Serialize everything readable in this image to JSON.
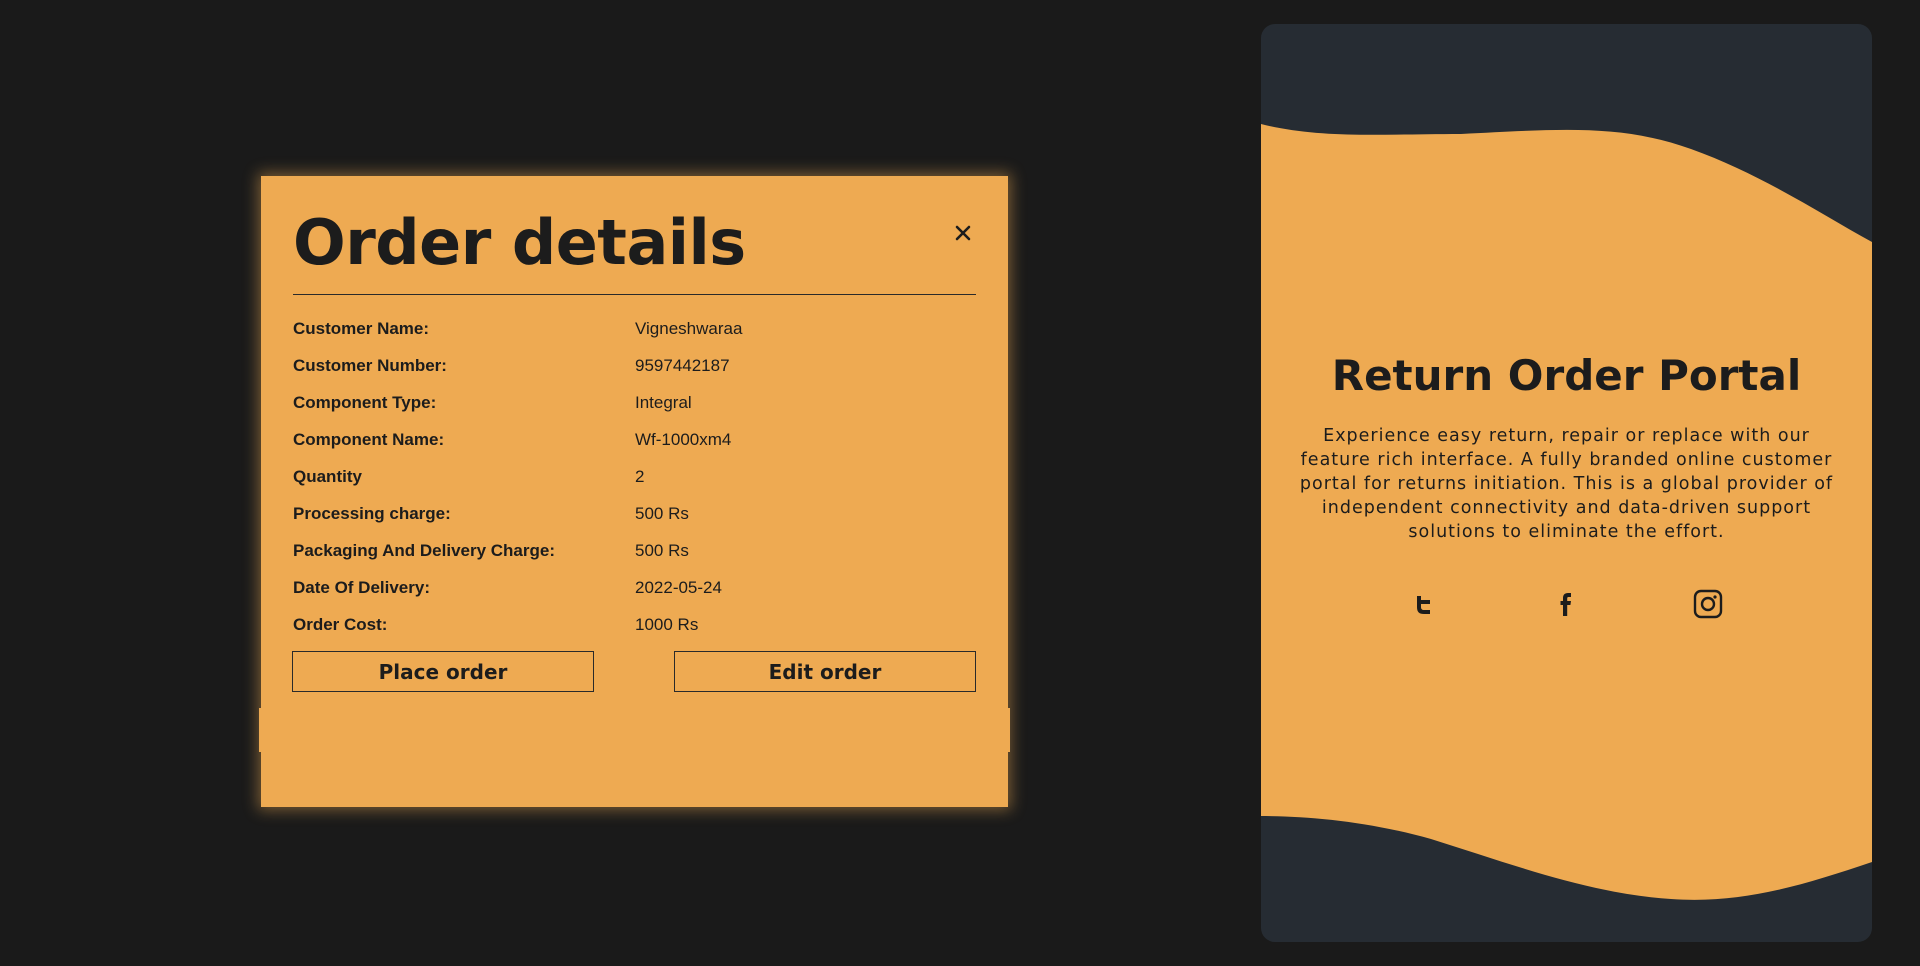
{
  "modal": {
    "title": "Order details",
    "close_icon": "close-icon",
    "rows": [
      {
        "label": "Customer Name:",
        "value": "Vigneshwaraa"
      },
      {
        "label": "Customer Number:",
        "value": "9597442187"
      },
      {
        "label": "Component Type:",
        "value": "Integral"
      },
      {
        "label": "Component Name:",
        "value": "Wf-1000xm4"
      },
      {
        "label": "Quantity",
        "value": "2"
      },
      {
        "label": "Processing charge:",
        "value": "500 Rs"
      },
      {
        "label": "Packaging And Delivery Charge:",
        "value": "500 Rs"
      },
      {
        "label": "Date Of Delivery:",
        "value": "2022-05-24"
      },
      {
        "label": "Order Cost:",
        "value": "1000 Rs"
      }
    ],
    "place_order_label": "Place order",
    "edit_order_label": "Edit order"
  },
  "panel": {
    "title": "Return Order Portal",
    "description": "Experience easy return, repair or replace with our feature rich interface. A fully branded online customer portal for returns initiation. This is a global provider of independent connectivity and data-driven support solutions to eliminate the effort.",
    "socials": [
      "twitter-icon",
      "facebook-icon",
      "instagram-icon"
    ]
  },
  "colors": {
    "background": "#1a1a1a",
    "accent": "#eeaa52",
    "panel_dark": "#262c33",
    "text": "#1c1c1c"
  }
}
